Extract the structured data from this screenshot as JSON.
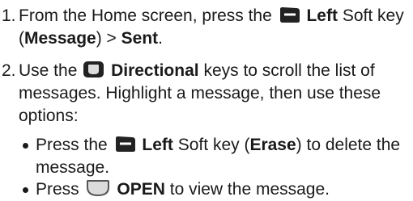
{
  "steps": [
    {
      "number": "1.",
      "text_a": "From the Home screen, press the",
      "key_name": "Left",
      "text_b": "Soft key",
      "open_paren": "(",
      "menu": "Message",
      "close_sep": ") >",
      "target": "Sent",
      "period": ".",
      "icon": "left-softkey-icon"
    },
    {
      "number": "2.",
      "text_a": "Use the",
      "key_name": "Directional",
      "text_b": "keys to scroll the list of",
      "line2": "messages. Highlight a message, then use these",
      "line3": "options:",
      "icon": "directional-key-icon"
    }
  ],
  "bullets": [
    {
      "text_a": "Press the",
      "key_name": "Left",
      "text_b": "Soft key (",
      "action": "Erase",
      "text_c": ") to delete the",
      "line2": "message.",
      "icon": "left-softkey-icon"
    },
    {
      "text_a": "Press",
      "key_name": "OPEN",
      "text_b": "to view the message.",
      "icon": "center-key-icon"
    }
  ],
  "colors": {
    "text": "#1a1a1a",
    "icon_dark": "#222222",
    "icon_mid": "#555555",
    "icon_light": "#dcdcdc"
  }
}
